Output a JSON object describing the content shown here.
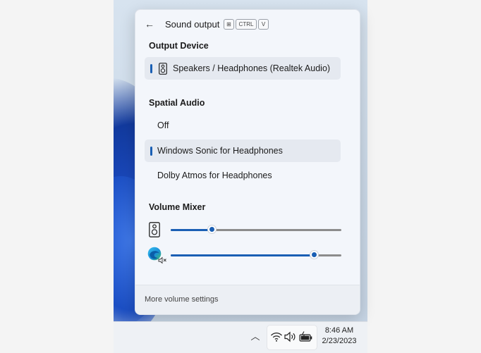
{
  "flyout": {
    "title": "Sound output",
    "shortcut": [
      "⊞",
      "CTRL",
      "V"
    ],
    "sections": {
      "output_device": "Output Device",
      "spatial_audio": "Spatial Audio",
      "volume_mixer": "Volume Mixer"
    },
    "output_devices": [
      {
        "label": "Speakers / Headphones (Realtek Audio)",
        "selected": true,
        "icon": "speaker-icon"
      }
    ],
    "spatial_options": [
      {
        "label": "Off",
        "selected": false
      },
      {
        "label": "Windows Sonic for Headphones",
        "selected": true
      },
      {
        "label": "Dolby Atmos for Headphones",
        "selected": false
      }
    ],
    "mixer": [
      {
        "app": "speakers",
        "icon": "speaker-icon",
        "volume": 0.24
      },
      {
        "app": "edge",
        "icon": "edge-icon",
        "muted": true,
        "volume": 0.84
      }
    ],
    "footer_link": "More volume settings"
  },
  "taskbar": {
    "time": "8:46 AM",
    "date": "2/23/2023"
  },
  "colors": {
    "accent": "#1a5fb4",
    "panel_bg": "#f3f6fb"
  }
}
